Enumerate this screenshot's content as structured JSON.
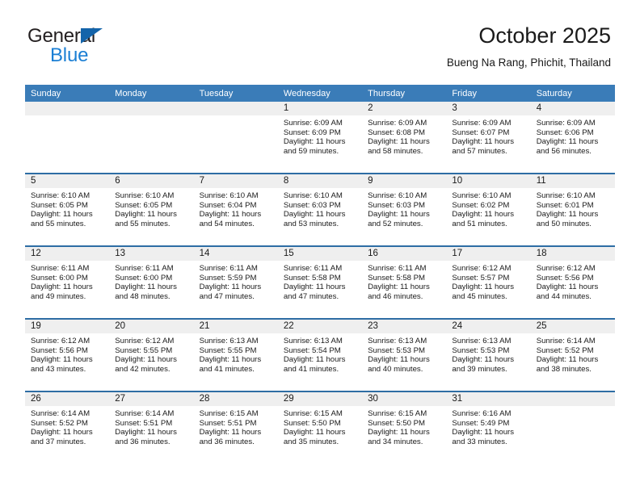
{
  "brand": {
    "name_part1": "General",
    "name_part2": "Blue",
    "triangle_color": "#1464aa",
    "blue_text_color": "#1b7fd4"
  },
  "header": {
    "title": "October 2025",
    "subtitle": "Bueng Na Rang, Phichit, Thailand"
  },
  "colors": {
    "header_band": "#3a7cb8",
    "week_divider": "#2e6da4",
    "daynum_band": "#efefef",
    "text": "#1a1a1a"
  },
  "calendar": {
    "day_headers": [
      "Sunday",
      "Monday",
      "Tuesday",
      "Wednesday",
      "Thursday",
      "Friday",
      "Saturday"
    ],
    "weeks": [
      [
        {
          "day": "",
          "blank": true,
          "sunrise": "",
          "sunset": "",
          "daylight_line1": "",
          "daylight_line2": ""
        },
        {
          "day": "",
          "blank": true,
          "sunrise": "",
          "sunset": "",
          "daylight_line1": "",
          "daylight_line2": ""
        },
        {
          "day": "",
          "blank": true,
          "sunrise": "",
          "sunset": "",
          "daylight_line1": "",
          "daylight_line2": ""
        },
        {
          "day": "1",
          "sunrise": "Sunrise: 6:09 AM",
          "sunset": "Sunset: 6:09 PM",
          "daylight_line1": "Daylight: 11 hours",
          "daylight_line2": "and 59 minutes."
        },
        {
          "day": "2",
          "sunrise": "Sunrise: 6:09 AM",
          "sunset": "Sunset: 6:08 PM",
          "daylight_line1": "Daylight: 11 hours",
          "daylight_line2": "and 58 minutes."
        },
        {
          "day": "3",
          "sunrise": "Sunrise: 6:09 AM",
          "sunset": "Sunset: 6:07 PM",
          "daylight_line1": "Daylight: 11 hours",
          "daylight_line2": "and 57 minutes."
        },
        {
          "day": "4",
          "sunrise": "Sunrise: 6:09 AM",
          "sunset": "Sunset: 6:06 PM",
          "daylight_line1": "Daylight: 11 hours",
          "daylight_line2": "and 56 minutes."
        }
      ],
      [
        {
          "day": "5",
          "sunrise": "Sunrise: 6:10 AM",
          "sunset": "Sunset: 6:05 PM",
          "daylight_line1": "Daylight: 11 hours",
          "daylight_line2": "and 55 minutes."
        },
        {
          "day": "6",
          "sunrise": "Sunrise: 6:10 AM",
          "sunset": "Sunset: 6:05 PM",
          "daylight_line1": "Daylight: 11 hours",
          "daylight_line2": "and 55 minutes."
        },
        {
          "day": "7",
          "sunrise": "Sunrise: 6:10 AM",
          "sunset": "Sunset: 6:04 PM",
          "daylight_line1": "Daylight: 11 hours",
          "daylight_line2": "and 54 minutes."
        },
        {
          "day": "8",
          "sunrise": "Sunrise: 6:10 AM",
          "sunset": "Sunset: 6:03 PM",
          "daylight_line1": "Daylight: 11 hours",
          "daylight_line2": "and 53 minutes."
        },
        {
          "day": "9",
          "sunrise": "Sunrise: 6:10 AM",
          "sunset": "Sunset: 6:03 PM",
          "daylight_line1": "Daylight: 11 hours",
          "daylight_line2": "and 52 minutes."
        },
        {
          "day": "10",
          "sunrise": "Sunrise: 6:10 AM",
          "sunset": "Sunset: 6:02 PM",
          "daylight_line1": "Daylight: 11 hours",
          "daylight_line2": "and 51 minutes."
        },
        {
          "day": "11",
          "sunrise": "Sunrise: 6:10 AM",
          "sunset": "Sunset: 6:01 PM",
          "daylight_line1": "Daylight: 11 hours",
          "daylight_line2": "and 50 minutes."
        }
      ],
      [
        {
          "day": "12",
          "sunrise": "Sunrise: 6:11 AM",
          "sunset": "Sunset: 6:00 PM",
          "daylight_line1": "Daylight: 11 hours",
          "daylight_line2": "and 49 minutes."
        },
        {
          "day": "13",
          "sunrise": "Sunrise: 6:11 AM",
          "sunset": "Sunset: 6:00 PM",
          "daylight_line1": "Daylight: 11 hours",
          "daylight_line2": "and 48 minutes."
        },
        {
          "day": "14",
          "sunrise": "Sunrise: 6:11 AM",
          "sunset": "Sunset: 5:59 PM",
          "daylight_line1": "Daylight: 11 hours",
          "daylight_line2": "and 47 minutes."
        },
        {
          "day": "15",
          "sunrise": "Sunrise: 6:11 AM",
          "sunset": "Sunset: 5:58 PM",
          "daylight_line1": "Daylight: 11 hours",
          "daylight_line2": "and 47 minutes."
        },
        {
          "day": "16",
          "sunrise": "Sunrise: 6:11 AM",
          "sunset": "Sunset: 5:58 PM",
          "daylight_line1": "Daylight: 11 hours",
          "daylight_line2": "and 46 minutes."
        },
        {
          "day": "17",
          "sunrise": "Sunrise: 6:12 AM",
          "sunset": "Sunset: 5:57 PM",
          "daylight_line1": "Daylight: 11 hours",
          "daylight_line2": "and 45 minutes."
        },
        {
          "day": "18",
          "sunrise": "Sunrise: 6:12 AM",
          "sunset": "Sunset: 5:56 PM",
          "daylight_line1": "Daylight: 11 hours",
          "daylight_line2": "and 44 minutes."
        }
      ],
      [
        {
          "day": "19",
          "sunrise": "Sunrise: 6:12 AM",
          "sunset": "Sunset: 5:56 PM",
          "daylight_line1": "Daylight: 11 hours",
          "daylight_line2": "and 43 minutes."
        },
        {
          "day": "20",
          "sunrise": "Sunrise: 6:12 AM",
          "sunset": "Sunset: 5:55 PM",
          "daylight_line1": "Daylight: 11 hours",
          "daylight_line2": "and 42 minutes."
        },
        {
          "day": "21",
          "sunrise": "Sunrise: 6:13 AM",
          "sunset": "Sunset: 5:55 PM",
          "daylight_line1": "Daylight: 11 hours",
          "daylight_line2": "and 41 minutes."
        },
        {
          "day": "22",
          "sunrise": "Sunrise: 6:13 AM",
          "sunset": "Sunset: 5:54 PM",
          "daylight_line1": "Daylight: 11 hours",
          "daylight_line2": "and 41 minutes."
        },
        {
          "day": "23",
          "sunrise": "Sunrise: 6:13 AM",
          "sunset": "Sunset: 5:53 PM",
          "daylight_line1": "Daylight: 11 hours",
          "daylight_line2": "and 40 minutes."
        },
        {
          "day": "24",
          "sunrise": "Sunrise: 6:13 AM",
          "sunset": "Sunset: 5:53 PM",
          "daylight_line1": "Daylight: 11 hours",
          "daylight_line2": "and 39 minutes."
        },
        {
          "day": "25",
          "sunrise": "Sunrise: 6:14 AM",
          "sunset": "Sunset: 5:52 PM",
          "daylight_line1": "Daylight: 11 hours",
          "daylight_line2": "and 38 minutes."
        }
      ],
      [
        {
          "day": "26",
          "sunrise": "Sunrise: 6:14 AM",
          "sunset": "Sunset: 5:52 PM",
          "daylight_line1": "Daylight: 11 hours",
          "daylight_line2": "and 37 minutes."
        },
        {
          "day": "27",
          "sunrise": "Sunrise: 6:14 AM",
          "sunset": "Sunset: 5:51 PM",
          "daylight_line1": "Daylight: 11 hours",
          "daylight_line2": "and 36 minutes."
        },
        {
          "day": "28",
          "sunrise": "Sunrise: 6:15 AM",
          "sunset": "Sunset: 5:51 PM",
          "daylight_line1": "Daylight: 11 hours",
          "daylight_line2": "and 36 minutes."
        },
        {
          "day": "29",
          "sunrise": "Sunrise: 6:15 AM",
          "sunset": "Sunset: 5:50 PM",
          "daylight_line1": "Daylight: 11 hours",
          "daylight_line2": "and 35 minutes."
        },
        {
          "day": "30",
          "sunrise": "Sunrise: 6:15 AM",
          "sunset": "Sunset: 5:50 PM",
          "daylight_line1": "Daylight: 11 hours",
          "daylight_line2": "and 34 minutes."
        },
        {
          "day": "31",
          "sunrise": "Sunrise: 6:16 AM",
          "sunset": "Sunset: 5:49 PM",
          "daylight_line1": "Daylight: 11 hours",
          "daylight_line2": "and 33 minutes."
        },
        {
          "day": "",
          "blank": true,
          "sunrise": "",
          "sunset": "",
          "daylight_line1": "",
          "daylight_line2": ""
        }
      ]
    ]
  }
}
